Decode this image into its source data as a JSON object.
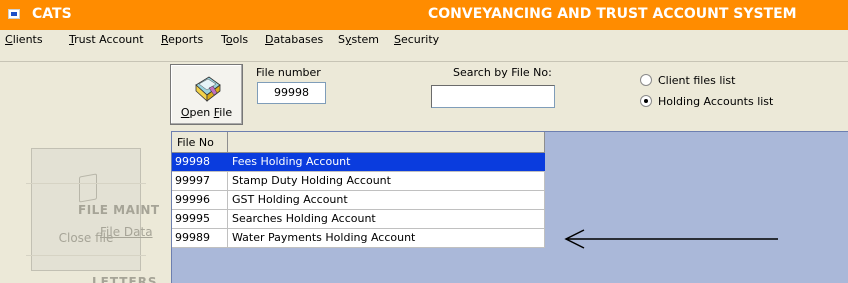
{
  "window": {
    "app_name": "CATS",
    "title": "CONVEYANCING AND TRUST ACCOUNT SYSTEM"
  },
  "menu": [
    {
      "before": "",
      "key": "C",
      "after": "lients"
    },
    {
      "before": "",
      "key": "T",
      "after": "rust Account"
    },
    {
      "before": "",
      "key": "R",
      "after": "eports"
    },
    {
      "before": "T",
      "key": "o",
      "after": "ols"
    },
    {
      "before": "",
      "key": "D",
      "after": "atabases"
    },
    {
      "before": "S",
      "key": "y",
      "after": "stem"
    },
    {
      "before": "",
      "key": "S",
      "after": "ecurity"
    }
  ],
  "toolbar": {
    "open_file": {
      "key": "O",
      "rest": "pen ",
      "key2": "F",
      "rest2": "ile"
    },
    "file_number_label": "File number",
    "file_number_value": "99998",
    "search_label": "Search by File No:",
    "search_value": "",
    "radio_client": "Client files list",
    "radio_holding": "Holding Accounts list",
    "selected_list": "Holding Accounts list"
  },
  "left_nav": {
    "close_file": "Close file",
    "file_maint": "FILE MAINT",
    "file_data": "File Data",
    "letters": "LETTERS"
  },
  "grid": {
    "headers": [
      "File No",
      ""
    ],
    "rows": [
      {
        "file_no": "99998",
        "name": "Fees Holding Account",
        "selected": true
      },
      {
        "file_no": "99997",
        "name": "Stamp Duty Holding Account",
        "selected": false
      },
      {
        "file_no": "99996",
        "name": "GST Holding Account",
        "selected": false
      },
      {
        "file_no": "99995",
        "name": "Searches Holding Account",
        "selected": false
      },
      {
        "file_no": "99989",
        "name": "Water Payments Holding Account",
        "selected": false
      }
    ]
  },
  "colors": {
    "title_bar": "#ff8c00",
    "selection": "#0a3cde",
    "grid_background": "#aab8d9"
  }
}
